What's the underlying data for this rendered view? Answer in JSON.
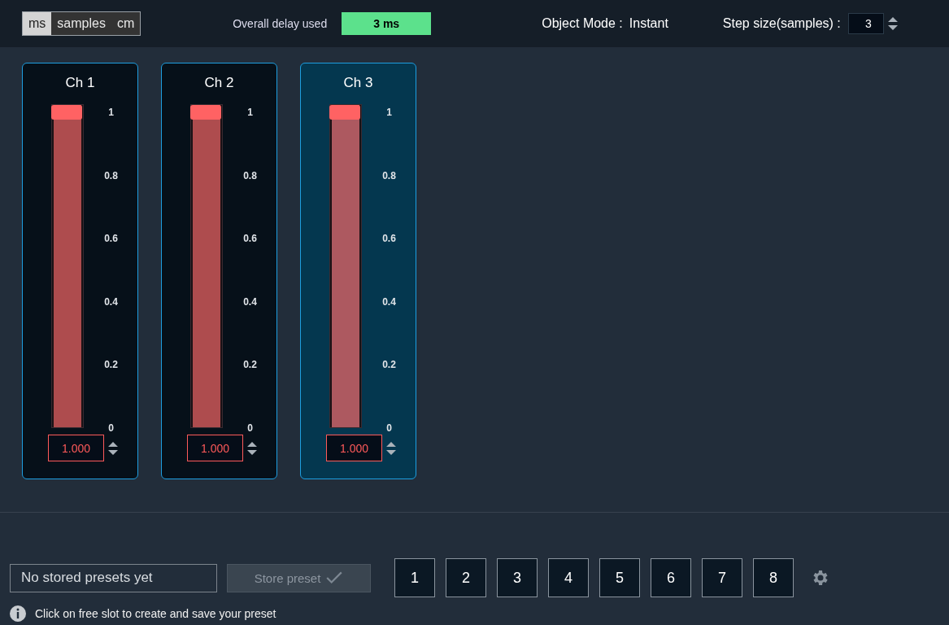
{
  "units": [
    {
      "label": "ms",
      "selected": true
    },
    {
      "label": "samples",
      "selected": false
    },
    {
      "label": "cm",
      "selected": false
    }
  ],
  "delay": {
    "label": "Overall delay used",
    "value": "3 ms"
  },
  "object_mode": {
    "label": "Object Mode :",
    "value": "Instant"
  },
  "step_size": {
    "label": "Step size(samples) :",
    "value": "3"
  },
  "channels": [
    {
      "name": "Ch 1",
      "selected": false,
      "level": 1,
      "scale": [
        "1",
        "0.8",
        "0.6",
        "0.4",
        "0.2",
        "0"
      ],
      "value": "1.000"
    },
    {
      "name": "Ch 2",
      "selected": false,
      "level": 1,
      "scale": [
        "1",
        "0.8",
        "0.6",
        "0.4",
        "0.2",
        "0"
      ],
      "value": "1.000"
    },
    {
      "name": "Ch 3",
      "selected": true,
      "level": 1,
      "scale": [
        "1",
        "0.8",
        "0.6",
        "0.4",
        "0.2",
        "0"
      ],
      "value": "1.000"
    }
  ],
  "presets": {
    "placeholder": "No stored presets yet",
    "store_button": {
      "label": "Store preset",
      "disabled": true
    },
    "hint": "Click on free slot to create and save your preset",
    "slots": [
      "1",
      "2",
      "3",
      "4",
      "5",
      "6",
      "7",
      "8"
    ]
  }
}
